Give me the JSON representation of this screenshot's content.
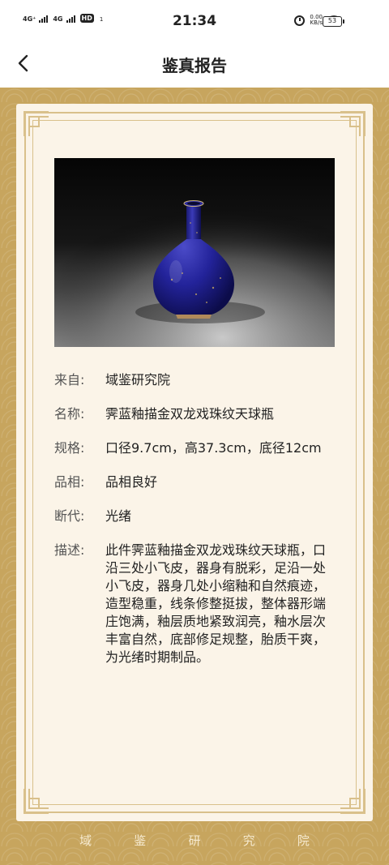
{
  "status_bar": {
    "sim1": "4G⁺",
    "sim2": "4G",
    "hd": "HD",
    "hd_sub": "1",
    "time": "21:34",
    "net_speed_value": "0.00",
    "net_speed_unit": "KB/s",
    "battery": "53"
  },
  "nav": {
    "title": "鉴真报告"
  },
  "report": {
    "items": [
      {
        "label": "来自:",
        "value": "域鉴研究院"
      },
      {
        "label": "名称:",
        "value": "霁蓝釉描金双龙戏珠纹天球瓶"
      },
      {
        "label": "规格:",
        "value": "口径9.7cm，高37.3cm，底径12cm"
      },
      {
        "label": "品相:",
        "value": "品相良好"
      },
      {
        "label": "断代:",
        "value": "光绪"
      },
      {
        "label": "描述:",
        "value": "此件霁蓝釉描金双龙戏珠纹天球瓶，口沿三处小飞皮，器身有脱彩，足沿一处小飞皮，器身几处小缩釉和自然痕迹，造型稳重，线条修整挺拔，整体器形端庄饱满，釉层质地紧致润亮，釉水层次丰富自然，底部修足规整，胎质干爽，为光绪时期制品。"
      }
    ]
  },
  "footer": {
    "chars": [
      "域",
      "鉴",
      "研",
      "究",
      "院"
    ]
  },
  "colors": {
    "gold": "#c7a55e",
    "card": "#fbf4e8",
    "vase_blue": "#1f1f8c"
  }
}
